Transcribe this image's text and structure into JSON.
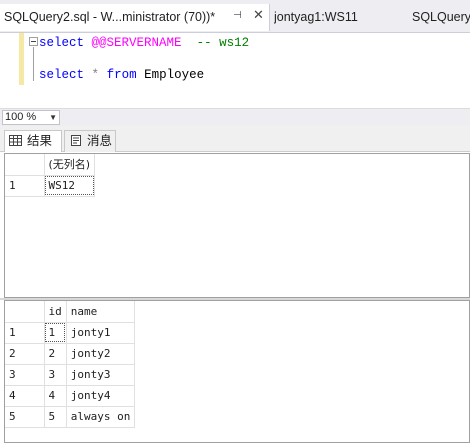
{
  "tabs": [
    {
      "label": "SQLQuery2.sql - W...ministrator (70))*"
    },
    {
      "label": "jontyag1:WS11"
    },
    {
      "label": "SQLQuery"
    }
  ],
  "tab_glyphs": {
    "pin": "⊣",
    "close": "✕"
  },
  "editor": {
    "line1": {
      "kw": "select",
      "var": "@@SERVERNAME",
      "cmt": "-- ws12"
    },
    "line2": {
      "kw1": "select",
      "star": "*",
      "kw2": "from",
      "table": "Employee"
    }
  },
  "zoom": {
    "value": "100 %"
  },
  "result_tabs": [
    {
      "label": "结果",
      "icon": "grid-icon"
    },
    {
      "label": "消息",
      "icon": "message-icon"
    }
  ],
  "grid1": {
    "columns": [
      "(无列名)"
    ],
    "rows": [
      [
        "1",
        "WS12"
      ]
    ]
  },
  "grid2": {
    "columns": [
      "id",
      "name"
    ],
    "rows": [
      [
        "1",
        "1",
        "jonty1"
      ],
      [
        "2",
        "2",
        "jonty2"
      ],
      [
        "3",
        "3",
        "jonty3"
      ],
      [
        "4",
        "4",
        "jonty4"
      ],
      [
        "5",
        "5",
        "always on"
      ]
    ]
  },
  "colors": {
    "keyword": "#0000ff",
    "variable": "#ff00ff",
    "comment": "#008000"
  }
}
